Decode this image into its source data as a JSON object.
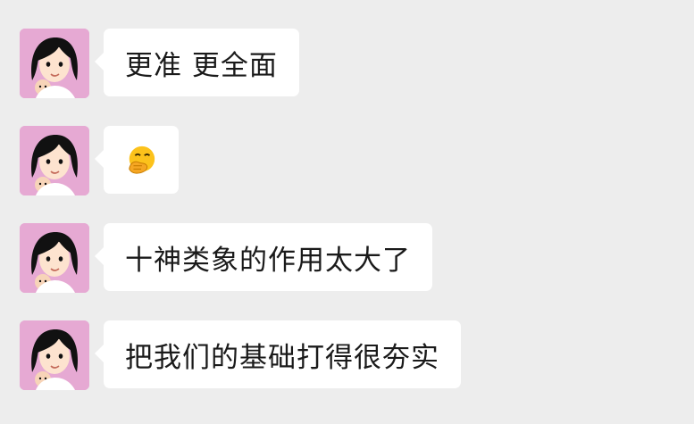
{
  "messages": [
    {
      "type": "text",
      "text": "更准 更全面"
    },
    {
      "type": "emoji",
      "icon": "smiling-face-with-hand-over-mouth-emoji"
    },
    {
      "type": "text",
      "text": "十神类象的作用太大了"
    },
    {
      "type": "text",
      "text": "把我们的基础打得很夯实"
    }
  ],
  "colors": {
    "background": "#ededed",
    "bubble": "#ffffff",
    "avatar_bg": "#e6a9d3",
    "text": "#1a1a1a"
  }
}
